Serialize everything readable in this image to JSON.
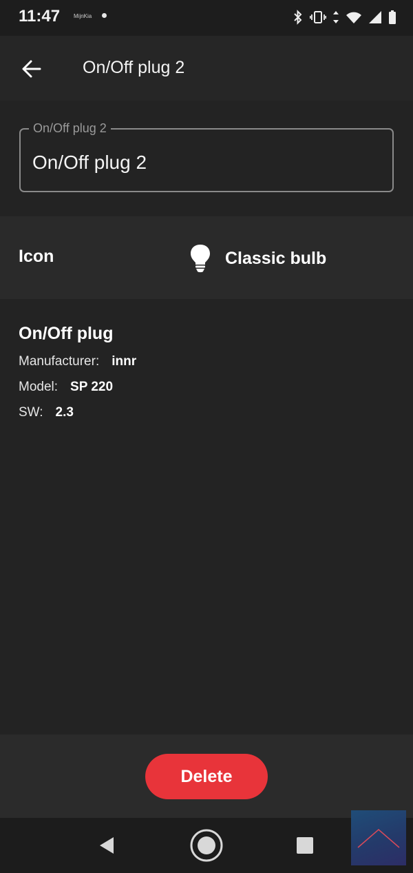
{
  "status_bar": {
    "time": "11:47",
    "carrier": "MijnKia",
    "icons": [
      "bluetooth-icon",
      "vibrate-icon",
      "data-arrows-icon",
      "wifi-icon",
      "cell-signal-icon",
      "battery-icon"
    ]
  },
  "app_bar": {
    "back_icon": "arrow-left-icon",
    "title": "On/Off plug 2"
  },
  "name_field": {
    "label": "On/Off plug 2",
    "value": "On/Off plug 2"
  },
  "icon_setting": {
    "label": "Icon",
    "icon": "classic-bulb-icon",
    "value": "Classic bulb"
  },
  "device_info": {
    "type": "On/Off plug",
    "manufacturer_label": "Manufacturer:",
    "manufacturer_value": "innr",
    "model_label": "Model:",
    "model_value": "SP 220",
    "sw_label": "SW:",
    "sw_value": "2.3"
  },
  "footer": {
    "delete_label": "Delete",
    "delete_color": "#e8343a"
  },
  "nav_bar": {
    "icons": [
      "nav-back-icon",
      "nav-home-icon",
      "nav-recents-icon"
    ]
  }
}
